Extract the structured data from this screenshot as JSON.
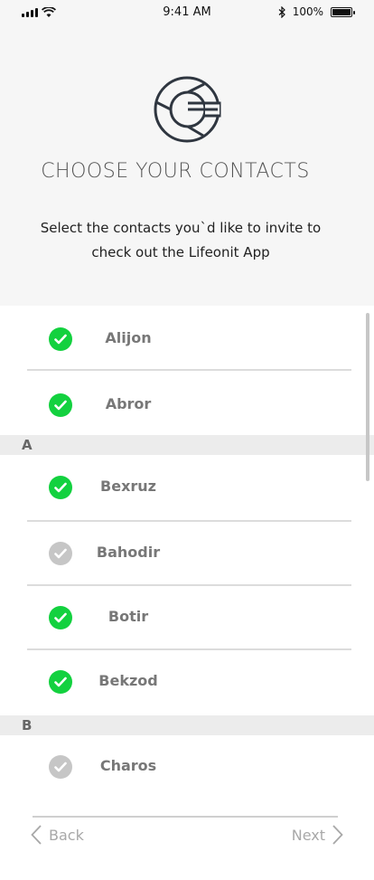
{
  "status_bar": {
    "time": "9:41 AM",
    "battery": "100%"
  },
  "header": {
    "title": "CHOOSE YOUR CONTACTS",
    "subtitle_line1": "Select the contacts you`d like to invite to",
    "subtitle_line2": "check out the Lifeonit App"
  },
  "contacts": [
    {
      "name": "Alijon",
      "selected": true
    },
    {
      "name": "Abror",
      "selected": true
    },
    {
      "name": "Bexruz",
      "selected": true
    },
    {
      "name": "Bahodir",
      "selected": false
    },
    {
      "name": "Botir",
      "selected": true
    },
    {
      "name": "Bekzod",
      "selected": true
    },
    {
      "name": "Charos",
      "selected": false
    }
  ],
  "sections": [
    "A",
    "B"
  ],
  "footer": {
    "back_label": "Back",
    "next_label": "Next"
  },
  "colors": {
    "selected": "#13d13f",
    "unselected": "#c6c6c6",
    "header_bg": "#f6f6f6"
  }
}
